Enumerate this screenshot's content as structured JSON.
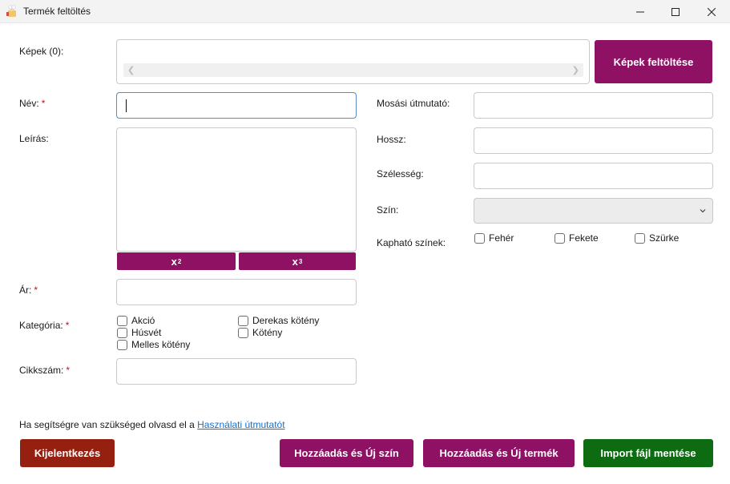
{
  "window": {
    "title": "Termék feltöltés"
  },
  "images": {
    "label": "Képek (0):",
    "upload_button": "Képek feltöltése"
  },
  "labels": {
    "name": "Név:",
    "description": "Leírás:",
    "price": "Ár:",
    "category": "Kategória:",
    "sku": "Cikkszám:",
    "wash": "Mosási útmutató:",
    "length": "Hossz:",
    "width": "Szélesség:",
    "color": "Szín:",
    "available_colors": "Kapható színek:",
    "required_mark": "*"
  },
  "superscript_buttons": [
    {
      "base": "x",
      "exp": "2"
    },
    {
      "base": "x",
      "exp": "3"
    }
  ],
  "categories": [
    "Akció",
    "Húsvét",
    "Melles kötény",
    "Derekas kötény",
    "Kötény"
  ],
  "colors": [
    "Fehér",
    "Fekete",
    "Szürke"
  ],
  "help": {
    "text": "Ha segítségre van szükséged olvasd el a ",
    "link": "Használati útmutatót"
  },
  "buttons": {
    "logout": "Kijelentkezés",
    "add_new_color": "Hozzáadás és Új szín",
    "add_new_product": "Hozzáadás és Új termék",
    "save_import": "Import fájl mentése"
  },
  "theme": {
    "accent": "#8e1164",
    "danger": "#962010",
    "success": "#0d6b12",
    "link": "#1b6ec2"
  }
}
